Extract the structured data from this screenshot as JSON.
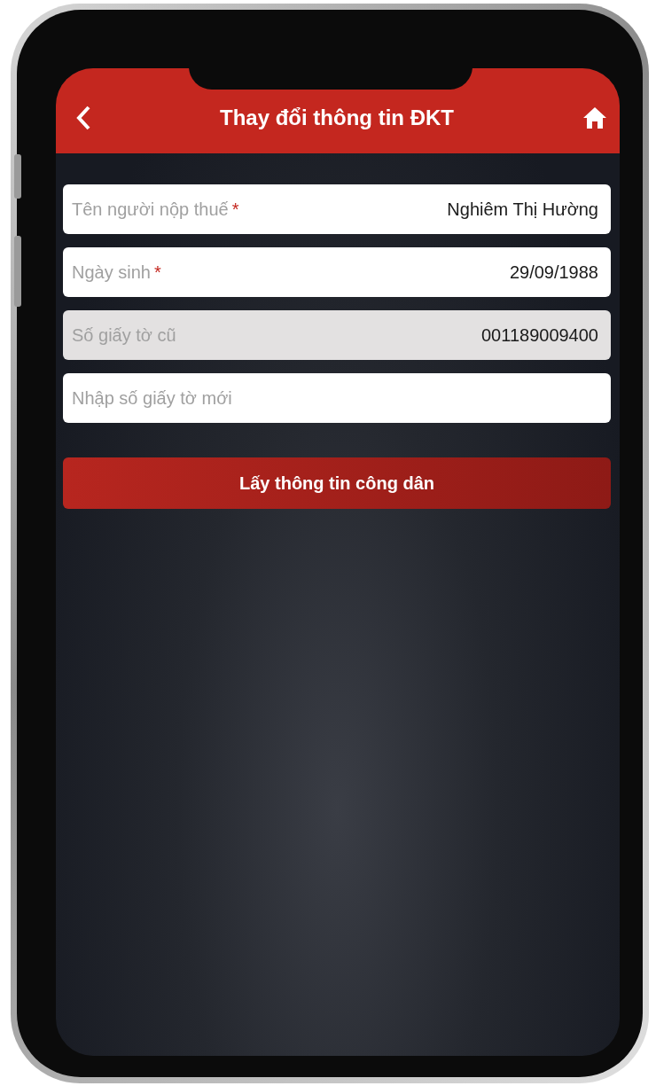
{
  "header": {
    "title": "Thay đổi thông tin ĐKT"
  },
  "fields": [
    {
      "label": "Tên người nộp thuế",
      "required_mark": "*",
      "value": "Nghiêm Thị Hường",
      "disabled": false
    },
    {
      "label": "Ngày sinh",
      "required_mark": "*",
      "value": "29/09/1988",
      "disabled": false
    },
    {
      "label": "Số giấy tờ cũ",
      "value": "001189009400",
      "disabled": true
    },
    {
      "placeholder": "Nhập số giấy tờ mới",
      "disabled": false
    }
  ],
  "button": {
    "label": "Lấy thông tin công dân"
  }
}
